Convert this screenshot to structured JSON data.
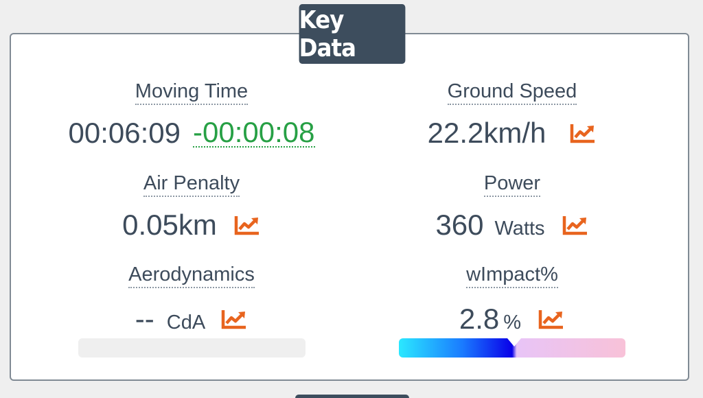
{
  "panel": {
    "title": "Key Data"
  },
  "metrics": {
    "moving_time": {
      "label": "Moving Time",
      "value": "00:06:09",
      "delta": "-00:00:08"
    },
    "ground_speed": {
      "label": "Ground Speed",
      "value": "22.2km/h",
      "icon": "trend-chart-icon"
    },
    "air_penalty": {
      "label": "Air Penalty",
      "value": "0.05km",
      "icon": "trend-chart-icon"
    },
    "power": {
      "label": "Power",
      "value": "360",
      "unit": "Watts",
      "icon": "trend-chart-icon"
    },
    "aerodynamics": {
      "label": "Aerodynamics",
      "value": "--",
      "unit": "CdA",
      "icon": "trend-chart-icon",
      "bar_level": null
    },
    "wimpact": {
      "label": "wImpact%",
      "value": "2.8",
      "unit": "%",
      "icon": "trend-chart-icon",
      "bar_level": 0.51
    }
  },
  "colors": {
    "accent_icon": "#e8641e",
    "delta_green": "#27a045",
    "title_bg": "#3d4d5d",
    "text": "#3d4b5b"
  }
}
